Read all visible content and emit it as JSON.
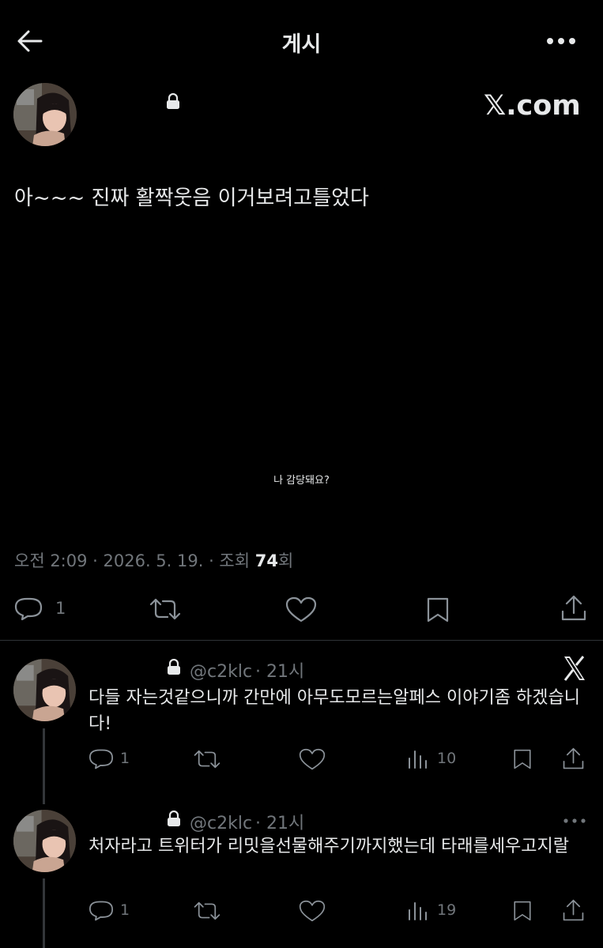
{
  "header": {
    "title": "게시"
  },
  "post": {
    "text": "아~~~ 진짜 활짝웃음 이거보려고틀었다",
    "watermark": "𝕏.com",
    "caption": "나 감당돼요?",
    "meta_time": "오전 2:09 · 2026. 5. 19. · 조회 ",
    "views": "74",
    "views_suffix": "회",
    "reply_count": "1"
  },
  "replies": [
    {
      "handle": "@c2klc",
      "time": "· 21시",
      "text": "다들 자는것같으니까 간만에 아무도모르는알페스 이야기좀 하겠습니다!",
      "reply_count": "1",
      "views": "10",
      "corner_icon": "x-logo-icon"
    },
    {
      "handle": "@c2klc",
      "time": "· 21시",
      "text": "처자라고 트위터가 리밋을선물해주기까지했는데 타래를세우고지랄",
      "reply_count": "1",
      "views": "19",
      "corner_icon": "more-icon"
    }
  ],
  "colors": {
    "background": "#000000",
    "text": "#e7e9ea",
    "muted": "#71767b",
    "divider": "#2f3336"
  }
}
